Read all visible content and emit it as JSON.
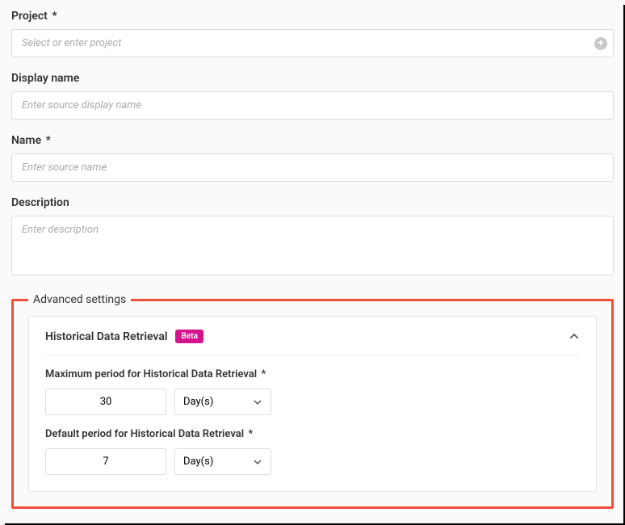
{
  "fields": {
    "project": {
      "label": "Project",
      "required": "*",
      "placeholder": "Select or enter project",
      "value": ""
    },
    "displayName": {
      "label": "Display name",
      "placeholder": "Enter source display name",
      "value": ""
    },
    "name": {
      "label": "Name",
      "required": "*",
      "placeholder": "Enter source name",
      "value": ""
    },
    "description": {
      "label": "Description",
      "placeholder": "Enter description",
      "value": ""
    }
  },
  "advanced": {
    "legend": "Advanced settings",
    "historical": {
      "title": "Historical Data Retrieval",
      "badge": "Beta",
      "max": {
        "label": "Maximum period for Historical Data Retrieval",
        "required": "*",
        "value": "30",
        "unit": "Day(s)"
      },
      "default": {
        "label": "Default period for Historical Data Retrieval",
        "required": "*",
        "value": "7",
        "unit": "Day(s)"
      }
    }
  }
}
